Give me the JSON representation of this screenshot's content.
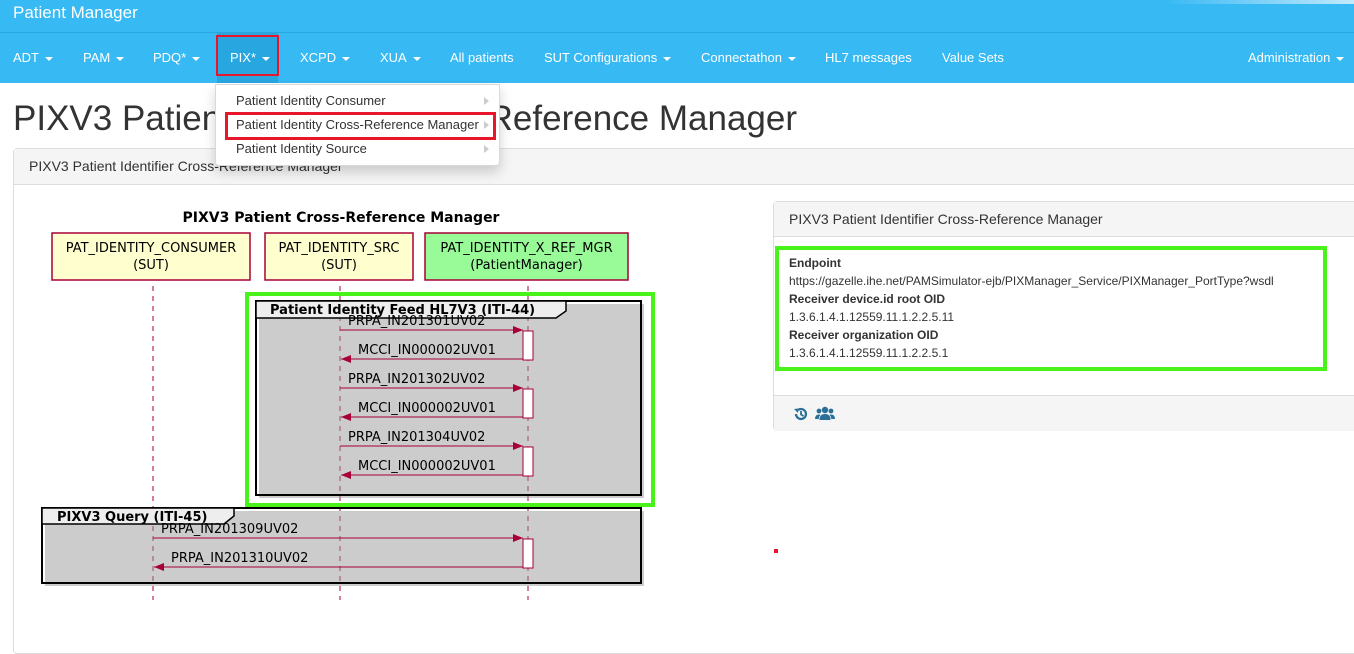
{
  "app": {
    "title": "Patient Manager"
  },
  "nav": {
    "items": [
      {
        "label": "ADT",
        "has_caret": true
      },
      {
        "label": "PAM",
        "has_caret": true
      },
      {
        "label": "PDQ*",
        "has_caret": true
      },
      {
        "label": "PIX*",
        "has_caret": true,
        "active": true
      },
      {
        "label": "XCPD",
        "has_caret": true
      },
      {
        "label": "XUA",
        "has_caret": true
      },
      {
        "label": "All patients",
        "has_caret": false
      },
      {
        "label": "SUT Configurations",
        "has_caret": true
      },
      {
        "label": "Connectathon",
        "has_caret": true
      },
      {
        "label": "HL7 messages",
        "has_caret": false
      },
      {
        "label": "Value Sets",
        "has_caret": false
      }
    ],
    "admin_label": "Administration"
  },
  "dropdown": {
    "items": [
      {
        "label": "Patient Identity Consumer"
      },
      {
        "label": "Patient Identity Cross-Reference Manager",
        "highlighted": true
      },
      {
        "label": "Patient Identity Source"
      }
    ]
  },
  "page": {
    "title": "PIXV3 Patient Identifier Cross-Reference Manager",
    "panel_heading": "PIXV3 Patient Identifier Cross-Reference Manager"
  },
  "diagram": {
    "title": "PIXV3 Patient Cross-Reference Manager",
    "participants": [
      {
        "line1": "PAT_IDENTITY_CONSUMER",
        "line2": "(SUT)",
        "fill": "#fefece"
      },
      {
        "line1": "PAT_IDENTITY_SRC",
        "line2": "(SUT)",
        "fill": "#fefece"
      },
      {
        "line1": "PAT_IDENTITY_X_REF_MGR",
        "line2": "(PatientManager)",
        "fill": "#98fb98"
      }
    ],
    "groups": [
      {
        "title": "Patient Identity Feed HL7V3 (ITI-44)",
        "messages": [
          {
            "label": "PRPA_IN201301UV02",
            "from": 1,
            "to": 2
          },
          {
            "label": "MCCI_IN000002UV01",
            "from": 2,
            "to": 1
          },
          {
            "label": "PRPA_IN201302UV02",
            "from": 1,
            "to": 2
          },
          {
            "label": "MCCI_IN000002UV01",
            "from": 2,
            "to": 1
          },
          {
            "label": "PRPA_IN201304UV02",
            "from": 1,
            "to": 2
          },
          {
            "label": "MCCI_IN000002UV01",
            "from": 2,
            "to": 1
          }
        ]
      },
      {
        "title": "PIXV3 Query (ITI-45)",
        "messages": [
          {
            "label": "PRPA_IN201309UV02",
            "from": 0,
            "to": 2
          },
          {
            "label": "PRPA_IN201310UV02",
            "from": 2,
            "to": 0
          }
        ]
      }
    ],
    "colors": {
      "arrow": "#a80036",
      "lifeline": "#a80036",
      "highlight_box": "#49f21a"
    }
  },
  "info": {
    "heading": "PIXV3 Patient Identifier Cross-Reference Manager",
    "endpoint_label": "Endpoint",
    "endpoint_value": "https://gazelle.ihe.net/PAMSimulator-ejb/PIXManager_Service/PIXManager_PortType?wsdl",
    "device_label": "Receiver device.id root OID",
    "device_value": "1.3.6.1.4.1.12559.11.1.2.2.5.11",
    "org_label": "Receiver organization OID",
    "org_value": "1.3.6.1.4.1.12559.11.1.2.2.5.1",
    "footer_icons": [
      "history-icon",
      "users-icon"
    ]
  },
  "colors": {
    "navbar": "#37b9f4",
    "highlight_red": "#e8162a",
    "highlight_green": "#49f21a"
  }
}
